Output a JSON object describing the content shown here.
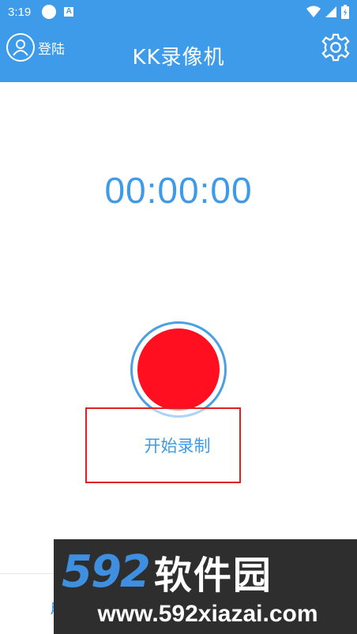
{
  "status_bar": {
    "time": "3:19",
    "icons": [
      "circle-icon",
      "a-notification-icon",
      "wifi-icon",
      "cell-signal-icon",
      "battery-icon"
    ]
  },
  "app_bar": {
    "login_label": "登陆",
    "title": "KK录像机",
    "icons": [
      "user-avatar-icon",
      "gear-icon"
    ]
  },
  "timer": {
    "value": "00:00:00"
  },
  "record": {
    "start_label": "开始录制"
  },
  "bottom": {
    "tab_fragment": "月"
  },
  "watermark": {
    "number": "592",
    "name": "软件园",
    "url": "www.592xiazai.com"
  },
  "colors": {
    "primary": "#3d9be9",
    "record_red": "#ff0f1f",
    "highlight_border": "#e02020",
    "watermark_bg": "#2e2e2e"
  }
}
